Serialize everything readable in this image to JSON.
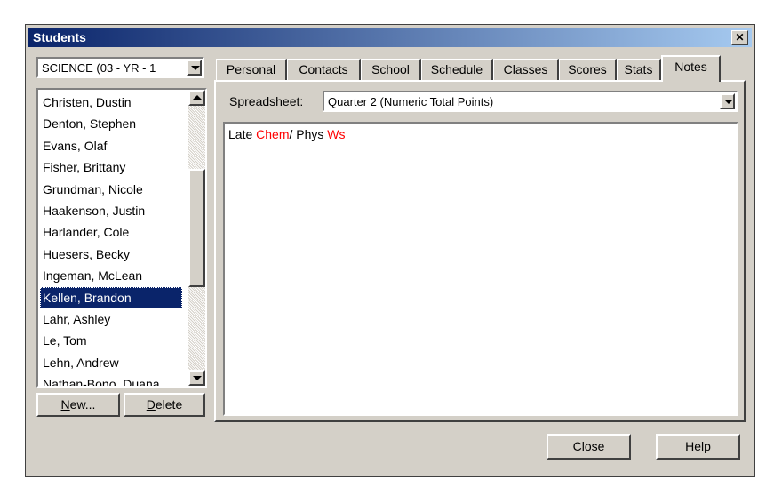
{
  "window": {
    "title": "Students",
    "close_glyph": "✕"
  },
  "class_select": {
    "value": "SCIENCE (03 - YR - 1"
  },
  "students": [
    "Christen, Dustin",
    "Denton, Stephen",
    "Evans, Olaf",
    "Fisher, Brittany",
    "Grundman, Nicole",
    "Haakenson, Justin",
    "Harlander, Cole",
    "Huesers, Becky",
    "Ingeman, McLean",
    "Kellen, Brandon",
    "Lahr, Ashley",
    "Le, Tom",
    "Lehn, Andrew",
    "Nathan-Bono, Duana"
  ],
  "selected_student": "Kellen, Brandon",
  "buttons": {
    "new_underline": "N",
    "new_rest": "ew...",
    "delete_underline": "D",
    "delete_rest": "elete",
    "close": "Close",
    "help": "Help"
  },
  "tabs": [
    "Personal",
    "Contacts",
    "School",
    "Schedule",
    "Classes",
    "Scores",
    "Stats",
    "Notes"
  ],
  "active_tab": "Notes",
  "spreadsheet": {
    "label": "Spreadsheet:",
    "value": "Quarter 2 (Numeric Total Points)"
  },
  "notes": {
    "part1": "Late ",
    "word1": "Chem",
    "part2": "/ Phys ",
    "word2": "Ws"
  },
  "colors": {
    "title_start": "#0a246a",
    "title_end": "#a6caf0",
    "selection": "#0a246a",
    "spellcheck": "#ff0000"
  }
}
